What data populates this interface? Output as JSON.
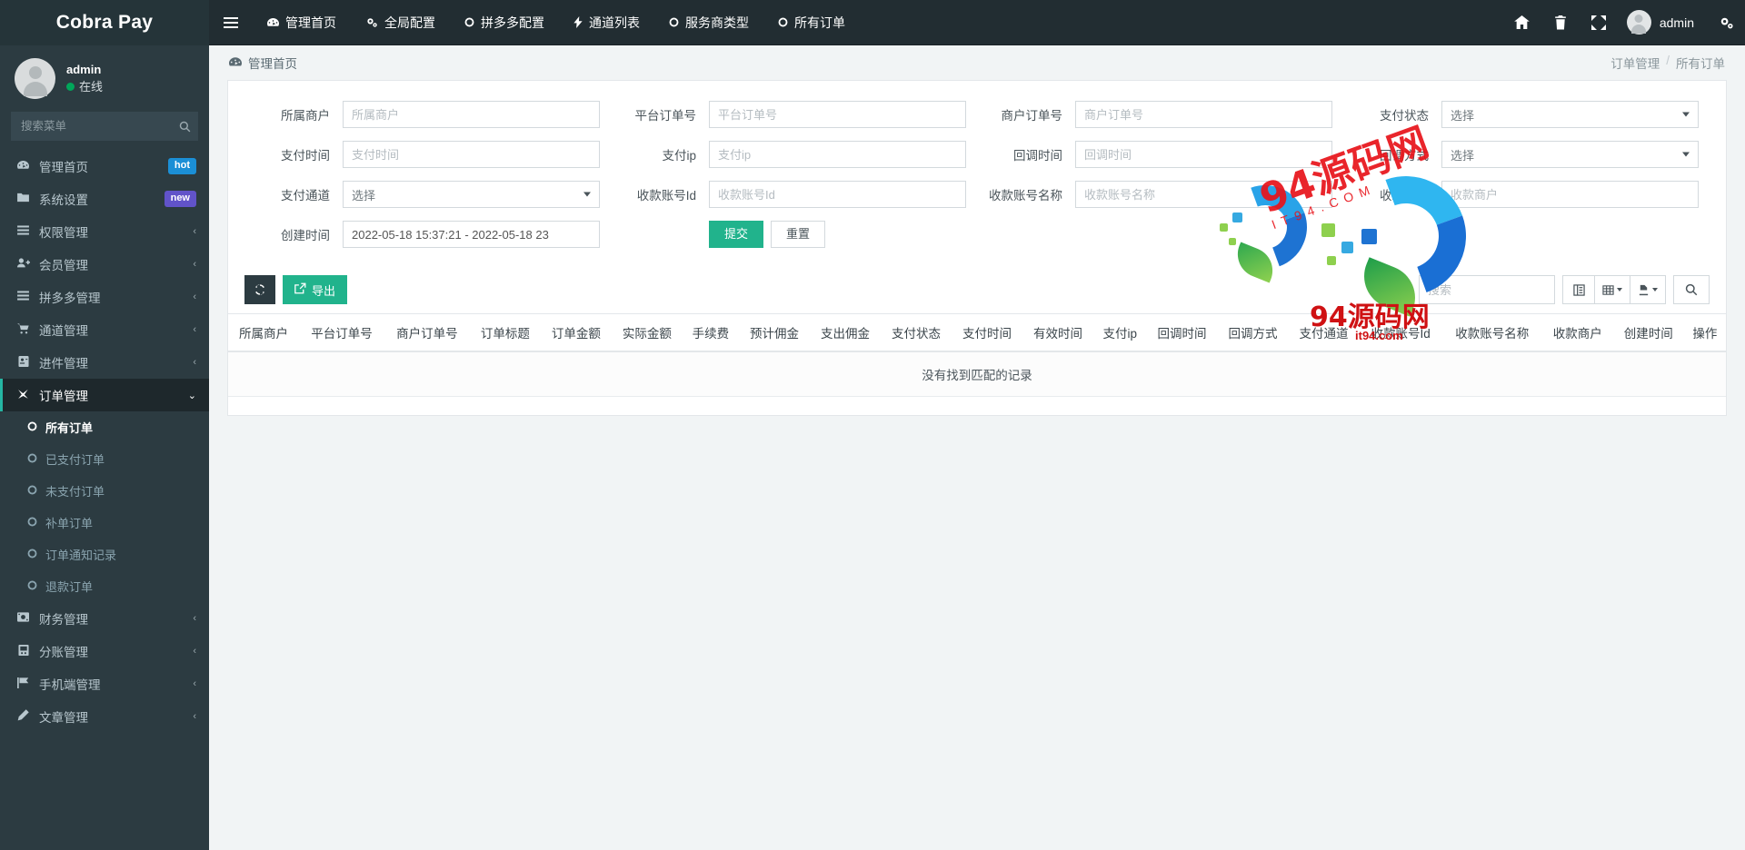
{
  "brand": {
    "title": "Cobra Pay"
  },
  "sidebar": {
    "user": {
      "name": "admin",
      "status": "在线"
    },
    "search": {
      "placeholder": "搜索菜单",
      "icon": "search-icon"
    },
    "items": [
      {
        "label": "管理首页",
        "icon": "dashboard-icon",
        "badge": "hot",
        "badge_color": "#1b8fd6",
        "arrow": ""
      },
      {
        "label": "系统设置",
        "icon": "folder-icon",
        "badge": "new",
        "badge_color": "#6153c9",
        "arrow": ""
      },
      {
        "label": "权限管理",
        "icon": "list-icon",
        "badge": "",
        "arrow": "‹"
      },
      {
        "label": "会员管理",
        "icon": "user-plus-icon",
        "badge": "",
        "arrow": "‹"
      },
      {
        "label": "拼多多管理",
        "icon": "list-icon",
        "badge": "",
        "arrow": "‹"
      },
      {
        "label": "通道管理",
        "icon": "cart-icon",
        "badge": "",
        "arrow": "‹"
      },
      {
        "label": "进件管理",
        "icon": "id-card-icon",
        "badge": "",
        "arrow": "‹"
      },
      {
        "label": "订单管理",
        "icon": "plane-icon",
        "badge": "",
        "arrow": "⌄",
        "active": true
      },
      {
        "label": "财务管理",
        "icon": "money-icon",
        "badge": "",
        "arrow": "‹"
      },
      {
        "label": "分账管理",
        "icon": "book-icon",
        "badge": "",
        "arrow": "‹"
      },
      {
        "label": "手机端管理",
        "icon": "flag-icon",
        "badge": "",
        "arrow": "‹"
      },
      {
        "label": "文章管理",
        "icon": "pencil-icon",
        "badge": "",
        "arrow": "‹"
      }
    ],
    "submenu": [
      {
        "label": "所有订单",
        "icon": "circle-icon",
        "active": true
      },
      {
        "label": "已支付订单",
        "icon": "circle-icon",
        "active": false
      },
      {
        "label": "未支付订单",
        "icon": "circle-icon",
        "active": false
      },
      {
        "label": "补单订单",
        "icon": "circle-icon",
        "active": false
      },
      {
        "label": "订单通知记录",
        "icon": "circle-icon",
        "active": false
      },
      {
        "label": "退款订单",
        "icon": "circle-icon",
        "active": false
      }
    ]
  },
  "topnav": {
    "hamburger_icon": "hamburger-icon",
    "links": [
      {
        "label": "管理首页",
        "icon": "dashboard-icon"
      },
      {
        "label": "全局配置",
        "icon": "gears-icon"
      },
      {
        "label": "拼多多配置",
        "icon": "circle-icon"
      },
      {
        "label": "通道列表",
        "icon": "bolt-icon"
      },
      {
        "label": "服务商类型",
        "icon": "circle-icon"
      },
      {
        "label": "所有订单",
        "icon": "circle-icon"
      }
    ],
    "right_icons": [
      {
        "name": "home-icon",
        "glyph": "⌂"
      },
      {
        "name": "trash-icon",
        "glyph": "🗑"
      },
      {
        "name": "fullscreen-icon",
        "glyph": "⤢"
      }
    ],
    "user_label": "admin",
    "gear_icon": "gears-icon"
  },
  "content": {
    "breadcrumb_left": "管理首页",
    "breadcrumb_left_icon": "dashboard-icon",
    "breadcrumb_right_parent": "订单管理",
    "breadcrumb_right_sep": "/",
    "breadcrumb_right_current": "所有订单"
  },
  "search_form": {
    "fields": [
      {
        "label": "所属商户",
        "type": "input",
        "value": "",
        "placeholder": "所属商户",
        "name": "merchant"
      },
      {
        "label": "平台订单号",
        "type": "input",
        "value": "",
        "placeholder": "平台订单号",
        "name": "platform-order-no"
      },
      {
        "label": "商户订单号",
        "type": "input",
        "value": "",
        "placeholder": "商户订单号",
        "name": "merchant-order-no"
      },
      {
        "label": "支付状态",
        "type": "select",
        "value": "选择",
        "name": "pay-status"
      },
      {
        "label": "支付时间",
        "type": "input",
        "value": "",
        "placeholder": "支付时间",
        "name": "pay-time"
      },
      {
        "label": "支付ip",
        "type": "input",
        "value": "",
        "placeholder": "支付ip",
        "name": "pay-ip"
      },
      {
        "label": "回调时间",
        "type": "input",
        "value": "",
        "placeholder": "回调时间",
        "name": "callback-time"
      },
      {
        "label": "回调方式",
        "type": "select",
        "value": "选择",
        "name": "callback-method"
      },
      {
        "label": "支付通道",
        "type": "select",
        "value": "选择",
        "name": "pay-channel"
      },
      {
        "label": "收款账号Id",
        "type": "input",
        "value": "",
        "placeholder": "收款账号Id",
        "name": "payee-account-id"
      },
      {
        "label": "收款账号名称",
        "type": "input",
        "value": "",
        "placeholder": "收款账号名称",
        "name": "payee-account-name"
      },
      {
        "label": "收款商户",
        "type": "input",
        "value": "",
        "placeholder": "收款商户",
        "name": "payee-merchant"
      }
    ],
    "create_time": {
      "label": "创建时间",
      "value": "2022-05-18 15:37:21 - 2022-05-18 23",
      "name": "create-time"
    },
    "submit_label": "提交",
    "reset_label": "重置"
  },
  "toolbar": {
    "refresh_icon": "refresh-icon",
    "export_label": "导出",
    "export_icon": "export-icon",
    "search_placeholder": "搜索",
    "search_value": "",
    "columns_icon": "columns-icon",
    "grid_icon": "grid-icon",
    "print_icon": "print-icon",
    "search_icon": "search-icon"
  },
  "table": {
    "columns": [
      "所属商户",
      "平台订单号",
      "商户订单号",
      "订单标题",
      "订单金额",
      "实际金额",
      "手续费",
      "预计佣金",
      "支出佣金",
      "支付状态",
      "支付时间",
      "有效时间",
      "支付ip",
      "回调时间",
      "回调方式",
      "支付通道",
      "收款账号Id",
      "收款账号名称",
      "收款商户",
      "创建时间",
      "操作"
    ],
    "rows": [],
    "empty_message": "没有找到匹配的记录"
  },
  "watermark": {
    "main_text": "94源码网",
    "sub_text": "IT94.COM",
    "bottom_text": "94源码网",
    "bottom_sub": "it94.com",
    "color": "#e8131a"
  }
}
